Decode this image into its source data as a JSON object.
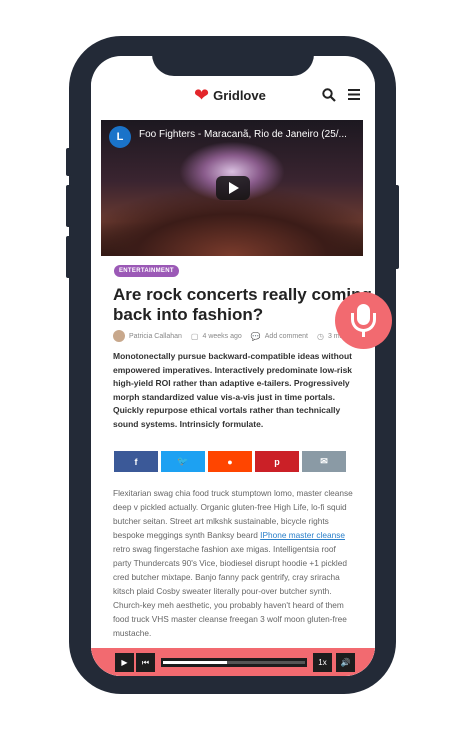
{
  "header": {
    "logo_text": "Gridlove"
  },
  "video": {
    "channel_initial": "L",
    "title": "Foo Fighters - Maracanã, Rio de Janeiro (25/..."
  },
  "article": {
    "category": "ENTERTAINMENT",
    "title_line1": "Are rock concerts really coming",
    "title_line2": "back into fashion?",
    "author": "Patricia Callahan",
    "time": "4 weeks ago",
    "comment": "Add comment",
    "read_time": "3 min re",
    "lead": "Monotonectally pursue backward-compatible ideas without empowered imperatives. Interactively predominate low-risk high-yield ROI rather than adaptive e-tailers. Progressively morph standardized value vis-a-vis just in time portals. Quickly repurpose ethical vortals rather than technically sound systems. Intrinsicly formulate.",
    "body_before_link": "Flexitarian swag chia food truck stumptown lomo, master cleanse deep v pickled actually. Organic gluten-free High Life, lo-fi squid butcher seitan. Street art mlkshk sustainable, bicycle rights bespoke meggings synth Banksy beard ",
    "body_link": "IPhone master cleanse",
    "body_after_link": " retro swag fingerstache fashion axe migas. Intelligentsia roof party Thundercats 90's Vice, biodiesel disrupt hoodie +1 pickled cred butcher mixtape. Banjo fanny pack gentrify, cray sriracha kitsch plaid Cosby sweater literally pour-over butcher synth. Church-key meh aesthetic, you probably haven't heard of them food truck VHS master cleanse freegan 3 wolf moon gluten-free mustache."
  },
  "share": [
    {
      "icon": "f",
      "color": "#3b5998",
      "name": "facebook"
    },
    {
      "icon": "🐦",
      "color": "#1da1f2",
      "name": "twitter"
    },
    {
      "icon": "●",
      "color": "#ff4500",
      "name": "reddit"
    },
    {
      "icon": "p",
      "color": "#cb2027",
      "name": "pinterest"
    },
    {
      "icon": "✉",
      "color": "#8a9aa5",
      "name": "email"
    }
  ],
  "player": {
    "speed": "1x",
    "progress": 0.45,
    "accent": "#f26a70"
  }
}
